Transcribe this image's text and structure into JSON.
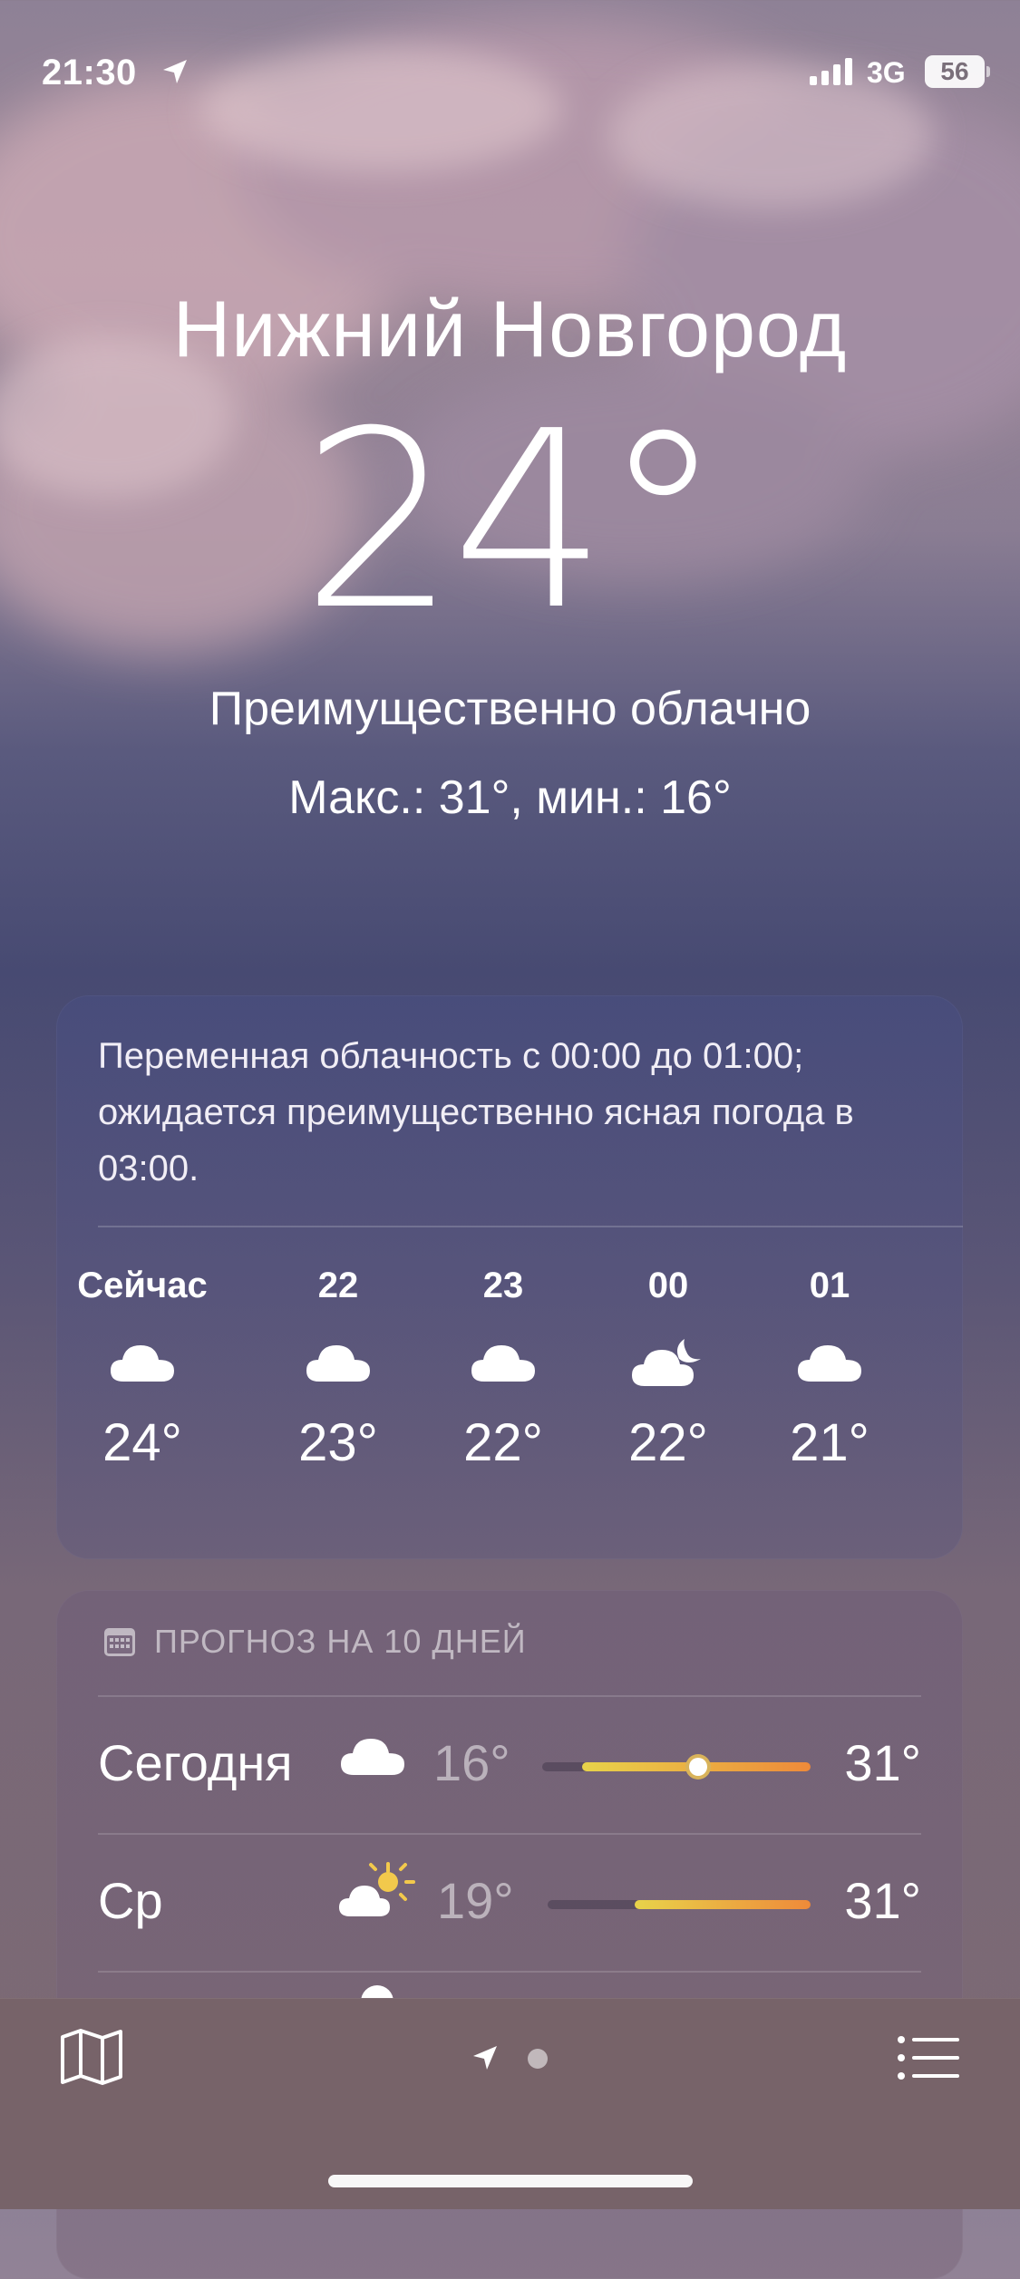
{
  "status_bar": {
    "time": "21:30",
    "network": "3G",
    "battery": "56"
  },
  "location": {
    "city": "Нижний Новгород",
    "temperature": "24°",
    "condition": "Преимущественно облачно",
    "high_low": "Макс.: 31°, мин.: 16°"
  },
  "hourly": {
    "summary": "Переменная облачность с 00:00 до 01:00; ожидается преимущественно ясная погода в 03:00.",
    "items": [
      {
        "label": "Сейчас",
        "icon": "cloud-icon",
        "temp": "24°"
      },
      {
        "label": "22",
        "icon": "cloud-icon",
        "temp": "23°"
      },
      {
        "label": "23",
        "icon": "cloud-icon",
        "temp": "22°"
      },
      {
        "label": "00",
        "icon": "cloud-moon-icon",
        "temp": "22°"
      },
      {
        "label": "01",
        "icon": "cloud-icon",
        "temp": "21°"
      }
    ]
  },
  "forecast": {
    "header": "ПРОГНОЗ НА 10 ДНЕЙ",
    "days": [
      {
        "day": "Сегодня",
        "icon": "cloud-icon",
        "low": "16°",
        "high": "31°",
        "range_start": 0.15,
        "range_end": 1.0,
        "current_marker": 0.58
      },
      {
        "day": "Ср",
        "icon": "cloud-sun-icon",
        "low": "19°",
        "high": "31°",
        "range_start": 0.33,
        "range_end": 1.0
      }
    ]
  },
  "colors": {
    "bar_yellow": "#e8d34a",
    "bar_orange": "#ee8a3a"
  }
}
